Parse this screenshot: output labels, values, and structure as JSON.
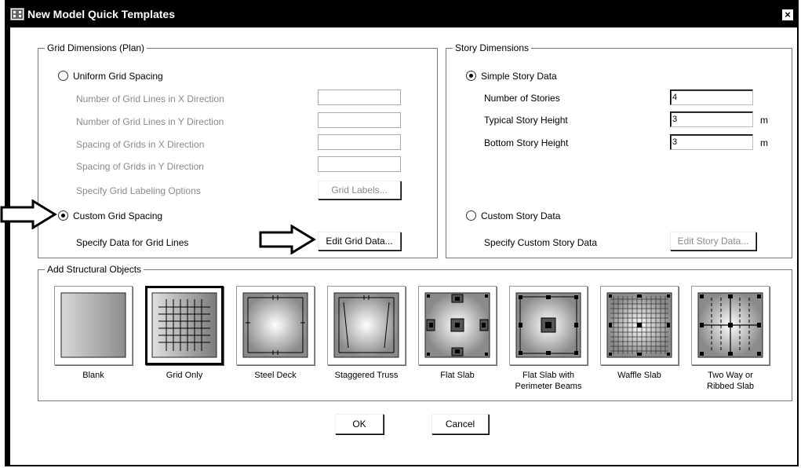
{
  "window": {
    "title": "New Model Quick Templates",
    "close_label": "×"
  },
  "grid": {
    "group_label": "Grid Dimensions (Plan)",
    "uniform_label": "Uniform Grid Spacing",
    "rows": [
      "Number of Grid Lines in X Direction",
      "Number of Grid Lines in Y Direction",
      "Spacing of Grids in X Direction",
      "Spacing of Grids in Y Direction",
      "Specify Grid Labeling Options"
    ],
    "grid_labels_button": "Grid Labels...",
    "custom_label": "Custom Grid Spacing",
    "custom_data_label": "Specify Data for Grid Lines",
    "edit_grid_button": "Edit Grid Data...",
    "selected": "custom"
  },
  "story": {
    "group_label": "Story Dimensions",
    "simple_label": "Simple Story Data",
    "num_stories_label": "Number of Stories",
    "num_stories_value": "4",
    "typical_height_label": "Typical Story Height",
    "typical_height_value": "3",
    "bottom_height_label": "Bottom Story Height",
    "bottom_height_value": "3",
    "unit": "m",
    "custom_label": "Custom Story Data",
    "custom_data_label": "Specify Custom Story Data",
    "edit_story_button": "Edit Story Data...",
    "selected": "simple"
  },
  "objects": {
    "group_label": "Add Structural Objects",
    "tiles": [
      {
        "name": "blank",
        "label1": "Blank",
        "label2": ""
      },
      {
        "name": "grid-only",
        "label1": "Grid Only",
        "label2": ""
      },
      {
        "name": "steel-deck",
        "label1": "Steel Deck",
        "label2": ""
      },
      {
        "name": "staggered-truss",
        "label1": "Staggered Truss",
        "label2": ""
      },
      {
        "name": "flat-slab",
        "label1": "Flat Slab",
        "label2": ""
      },
      {
        "name": "flat-slab-perimeter",
        "label1": "Flat Slab with",
        "label2": "Perimeter Beams"
      },
      {
        "name": "waffle-slab",
        "label1": "Waffle Slab",
        "label2": ""
      },
      {
        "name": "two-way-ribbed",
        "label1": "Two Way or",
        "label2": "Ribbed Slab"
      }
    ],
    "selected": "grid-only"
  },
  "footer": {
    "ok": "OK",
    "cancel": "Cancel"
  }
}
